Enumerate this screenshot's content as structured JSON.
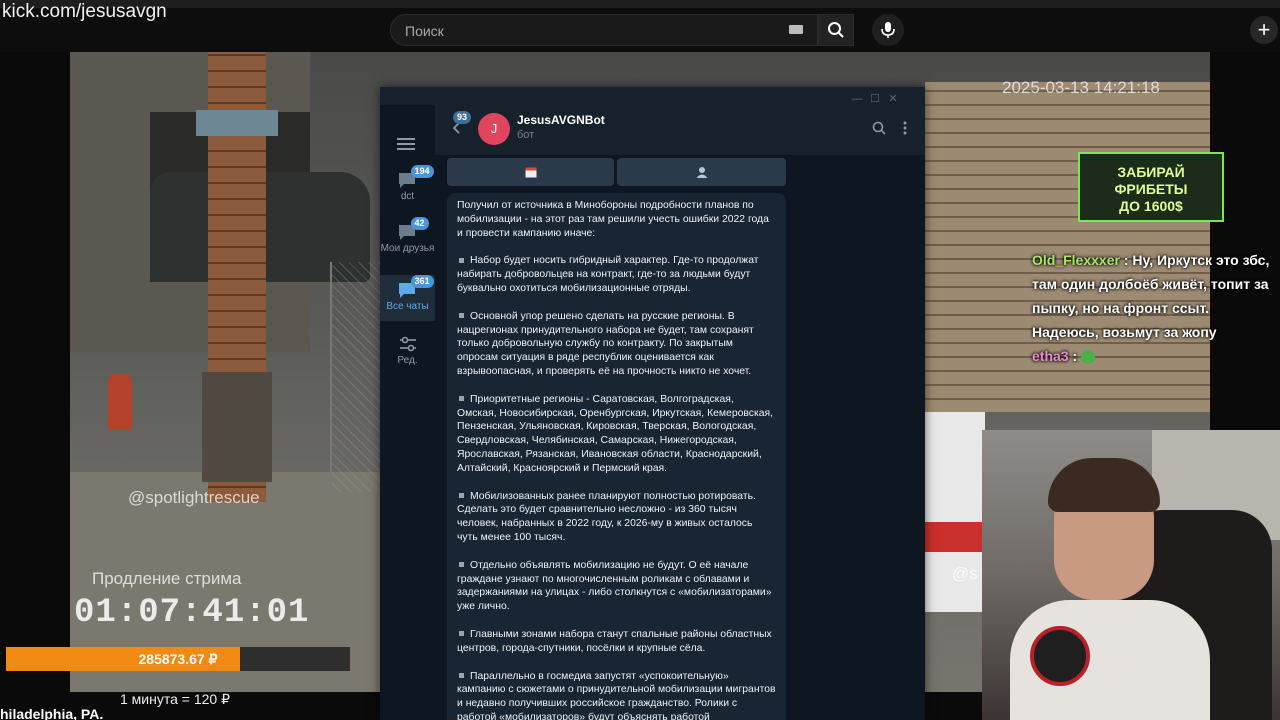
{
  "browser": {
    "url": "kick.com/jesusavgn",
    "search_placeholder": "Поиск",
    "new_tab_label": "+"
  },
  "stream": {
    "extension_label": "Продление стрима",
    "timer": "01:07:41:01",
    "donation_amount": "285873.67 ₽",
    "donation_progress_fraction": 0.68,
    "rate": "1 минута = 120 ₽",
    "location": "hiladelphia, PA."
  },
  "camera": {
    "watermark_left": "@spotlightrescue",
    "watermark_right": "@s",
    "timestamp": "2025-03-13 14:21:18"
  },
  "promo": {
    "line1": "ЗАБИРАЙ",
    "line2": "ФРИБЕТЫ",
    "line3": "ДО 1600$"
  },
  "chat": [
    {
      "user": "Old_Flexxxer",
      "sep": " : ",
      "text": "Ну, Иркутск это збс, там один долбоёб живёт, топит за пыпку, но на фронт ссыт. Надеюсь, возьмут за жопу"
    },
    {
      "user": "etha3",
      "sep": " : ",
      "text": ""
    }
  ],
  "telegram": {
    "window_controls": [
      "—",
      "☐",
      "✕"
    ],
    "folders": [
      {
        "label": "dct",
        "badge": "194",
        "icon": "chat-bubble-icon"
      },
      {
        "label": "Мои друзья",
        "badge": "42",
        "icon": "chat-bubble-icon"
      },
      {
        "label": "Все чаты",
        "badge": "361",
        "icon": "chats-icon"
      },
      {
        "label": "Ред.",
        "badge": "",
        "icon": "sliders-icon"
      }
    ],
    "back_badge": "93",
    "chat": {
      "avatar_letter": "J",
      "title": "JesusAVGNBot",
      "subtitle": "бот"
    },
    "message": [
      "Получил от источника в Минобороны подробности планов по мобилизации - на этот раз там решили учесть ошибки 2022 года и провести кампанию иначе:",
      "Набор будет носить гибридный характер. Где-то продолжат набирать добровольцев на контракт, где-то за людьми будут буквально охотиться мобилизационные отряды.",
      "Основной упор решено сделать на русские регионы. В нацрегионах принудительного набора не будет, там сохранят только добровольную службу по контракту. По закрытым опросам ситуация в ряде республик оценивается как взрывоопасная, и проверять её на прочность никто не хочет.",
      "Приоритетные регионы - Саратовская, Волгоградская, Омская, Новосибирская, Оренбургская, Иркутская, Кемеровская, Пензенская, Ульяновская, Кировская, Тверская, Вологодская, Свердловская, Челябинская, Самарская, Нижегородская, Ярославская, Рязанская, Ивановская области, Краснодарский, Алтайский, Красноярский и Пермский края.",
      "Мобилизованных ранее планируют полностью ротировать. Сделать это будет сравнительно несложно - из 360 тысяч человек, набранных в 2022 году, к 2026-му в живых осталось чуть менее 100 тысяч.",
      "Отдельно объявлять мобилизацию не будут. О её начале граждане узнают по многочисленным роликам с облавами и задержаниями на улицах - либо столкнутся с «мобилизаторами» уже лично.",
      "Главными зонами набора станут спальные районы областных центров, города-спутники, посёлки и крупные сёла.",
      "Параллельно в госмедиа запустят «успокоительную» кампанию с сюжетами о принудительной мобилизации мигрантов и недавно получивших российское гражданство. Ролики с работой «мобилизаторов» будут объяснять работой"
    ]
  },
  "colors": {
    "accent_orange": "#f08a12",
    "telegram_accent": "#5ea8ec",
    "promo_green": "#7be84b"
  }
}
